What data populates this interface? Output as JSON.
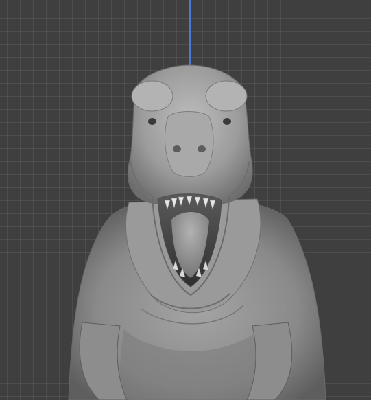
{
  "viewport": {
    "background": "#3f3f3f",
    "grid_color": "#4b4b4b",
    "axis_color": "#4a7bd0"
  },
  "model": {
    "subject": "t-rex-sculpt",
    "material_color": "#8e8e8e",
    "shadow_color": "#4d4d4d",
    "highlight_color": "#c9c9c9"
  }
}
